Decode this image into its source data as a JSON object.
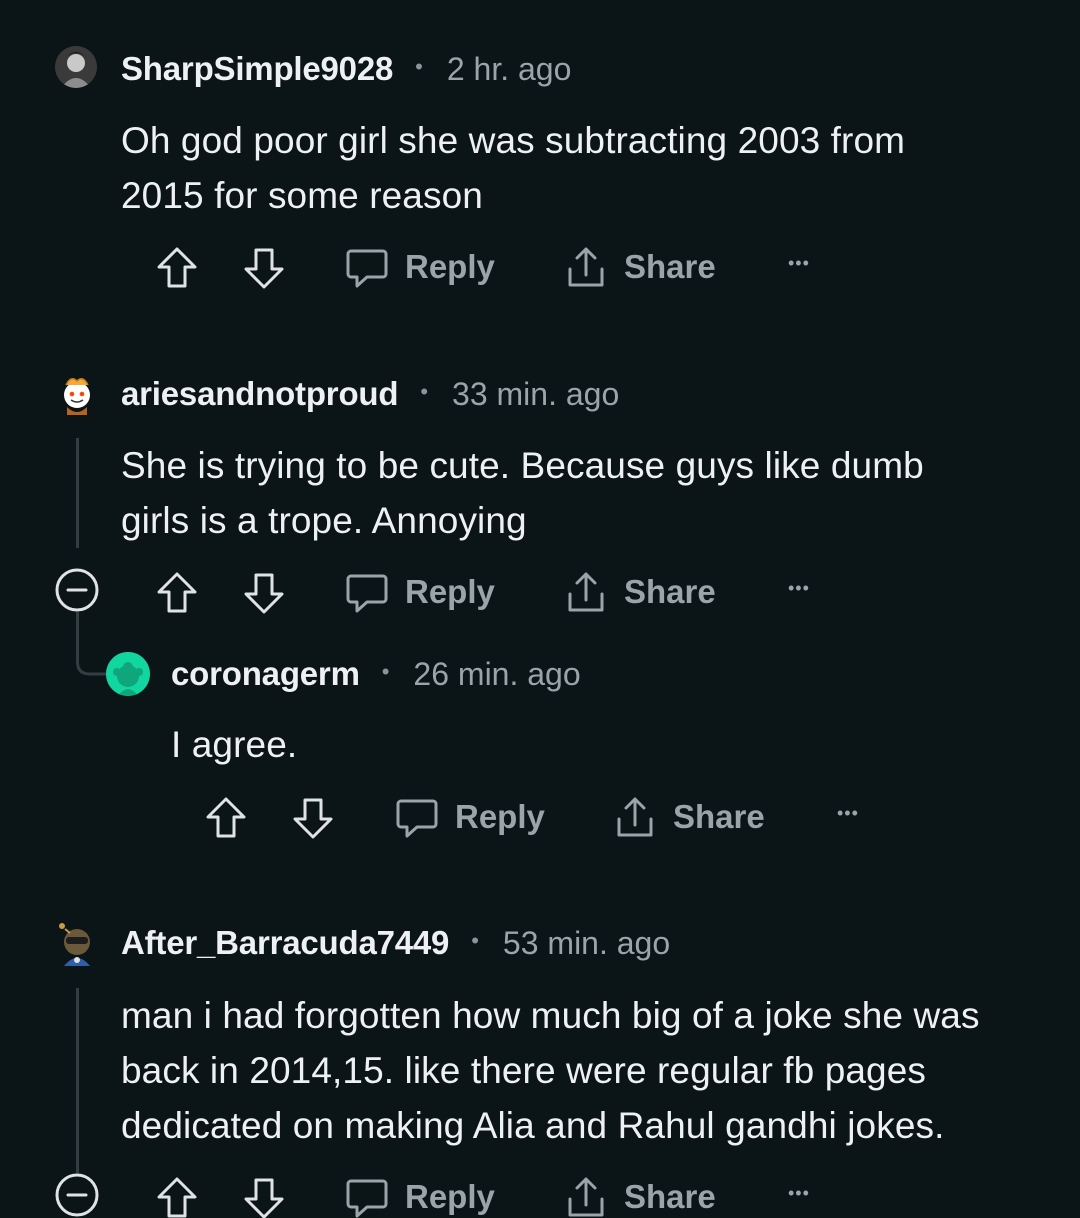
{
  "comments": [
    {
      "username": "SharpSimple9028",
      "separator": "•",
      "time": "2 hr. ago",
      "lines": [
        "Oh god poor girl she was subtracting 2003 from",
        "2015 for some reason"
      ],
      "actions": {
        "reply": "Reply",
        "share": "Share",
        "more": "•••"
      }
    },
    {
      "username": "ariesandnotproud",
      "separator": "•",
      "time": "33 min. ago",
      "lines": [
        "She is trying to be cute. Because guys like dumb",
        "girls is a trope. Annoying"
      ],
      "actions": {
        "reply": "Reply",
        "share": "Share",
        "more": "•••"
      }
    },
    {
      "username": "coronagerm",
      "separator": "•",
      "time": "26 min. ago",
      "lines": [
        "I agree."
      ],
      "actions": {
        "reply": "Reply",
        "share": "Share",
        "more": "•••"
      }
    },
    {
      "username": "After_Barracuda7449",
      "separator": "•",
      "time": "53 min. ago",
      "lines": [
        "man i had forgotten how much big of a joke she was",
        "back in 2014,15. like there were regular fb pages",
        "dedicated on making Alia and Rahul gandhi jokes."
      ],
      "actions": {
        "reply": "Reply",
        "share": "Share",
        "more": "•••"
      }
    }
  ],
  "colors": {
    "background": "#0b1416",
    "text": "#eef1f3",
    "muted": "#9aa4a9",
    "coronagerm_avatar": "#12d6a0"
  },
  "icons": [
    "upvote-icon",
    "downvote-icon",
    "reply-bubble-icon",
    "share-icon",
    "more-icon",
    "collapse-icon"
  ]
}
